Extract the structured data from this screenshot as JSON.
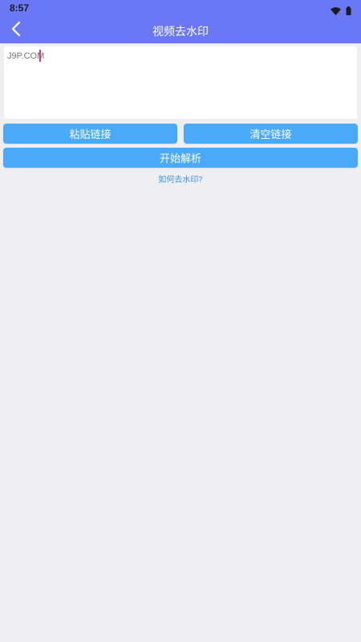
{
  "status_bar": {
    "time": "8:57",
    "icons": [
      "wifi-icon",
      "battery-icon"
    ]
  },
  "header": {
    "title": "视频去水印",
    "back_icon": "back-arrow-icon"
  },
  "link_input": {
    "value": "",
    "placeholder": "J9P.COM"
  },
  "buttons": {
    "paste_label": "粘贴链接",
    "clear_label": "清空链接",
    "parse_label": "开始解析"
  },
  "help_link": "如何去水印?",
  "colors": {
    "header_bg": "#6a78f5",
    "button_bg": "#4aa9f8",
    "page_bg": "#efeef3",
    "link": "#3d8ff2",
    "cursor": "#d23a6b"
  }
}
